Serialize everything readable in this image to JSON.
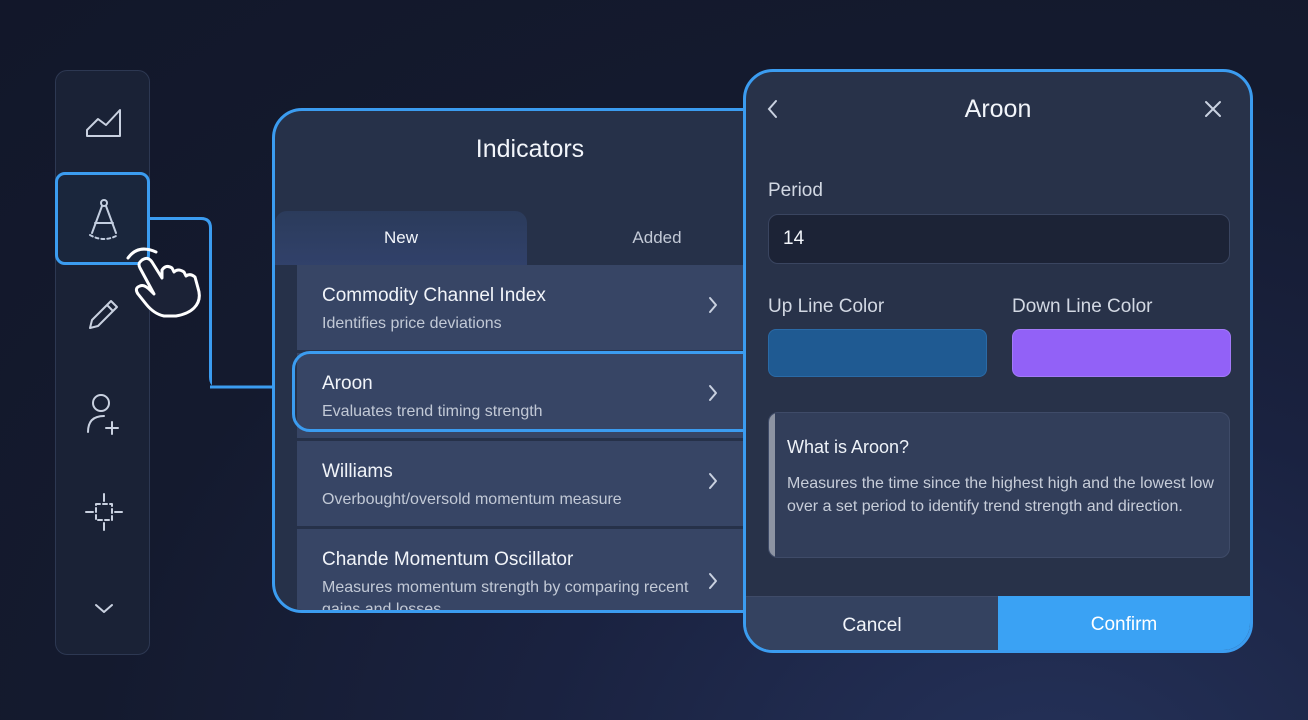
{
  "toolbar": {
    "icons": [
      "chart-area-icon",
      "compass-icon",
      "pencil-icon",
      "add-user-icon",
      "crosshair-icon",
      "chevron-down-icon"
    ]
  },
  "indicators": {
    "title": "Indicators",
    "tabs": [
      {
        "label": "New",
        "active": true
      },
      {
        "label": "Added",
        "active": false
      }
    ],
    "items": [
      {
        "title": "Commodity Channel Index",
        "subtitle": "Identifies price deviations"
      },
      {
        "title": "Aroon",
        "subtitle": "Evaluates trend timing strength",
        "selected": true
      },
      {
        "title": "Williams",
        "subtitle": "Overbought/oversold momentum measure"
      },
      {
        "title": "Chande Momentum Oscillator",
        "subtitle": "Measures momentum strength by comparing recent gains and losses."
      }
    ]
  },
  "aroon": {
    "title": "Aroon",
    "period_label": "Period",
    "period_value": "14",
    "up_label": "Up Line Color",
    "down_label": "Down Line Color",
    "up_color": "#1f5a92",
    "down_color": "#9261f7",
    "info_title": "What is Aroon?",
    "info_text": "Measures the time since the highest high and the lowest low over a set period to identify trend strength and direction.",
    "cancel_label": "Cancel",
    "confirm_label": "Confirm"
  },
  "colors": {
    "accent": "#3b9cf0",
    "confirm": "#3aa2f4"
  }
}
